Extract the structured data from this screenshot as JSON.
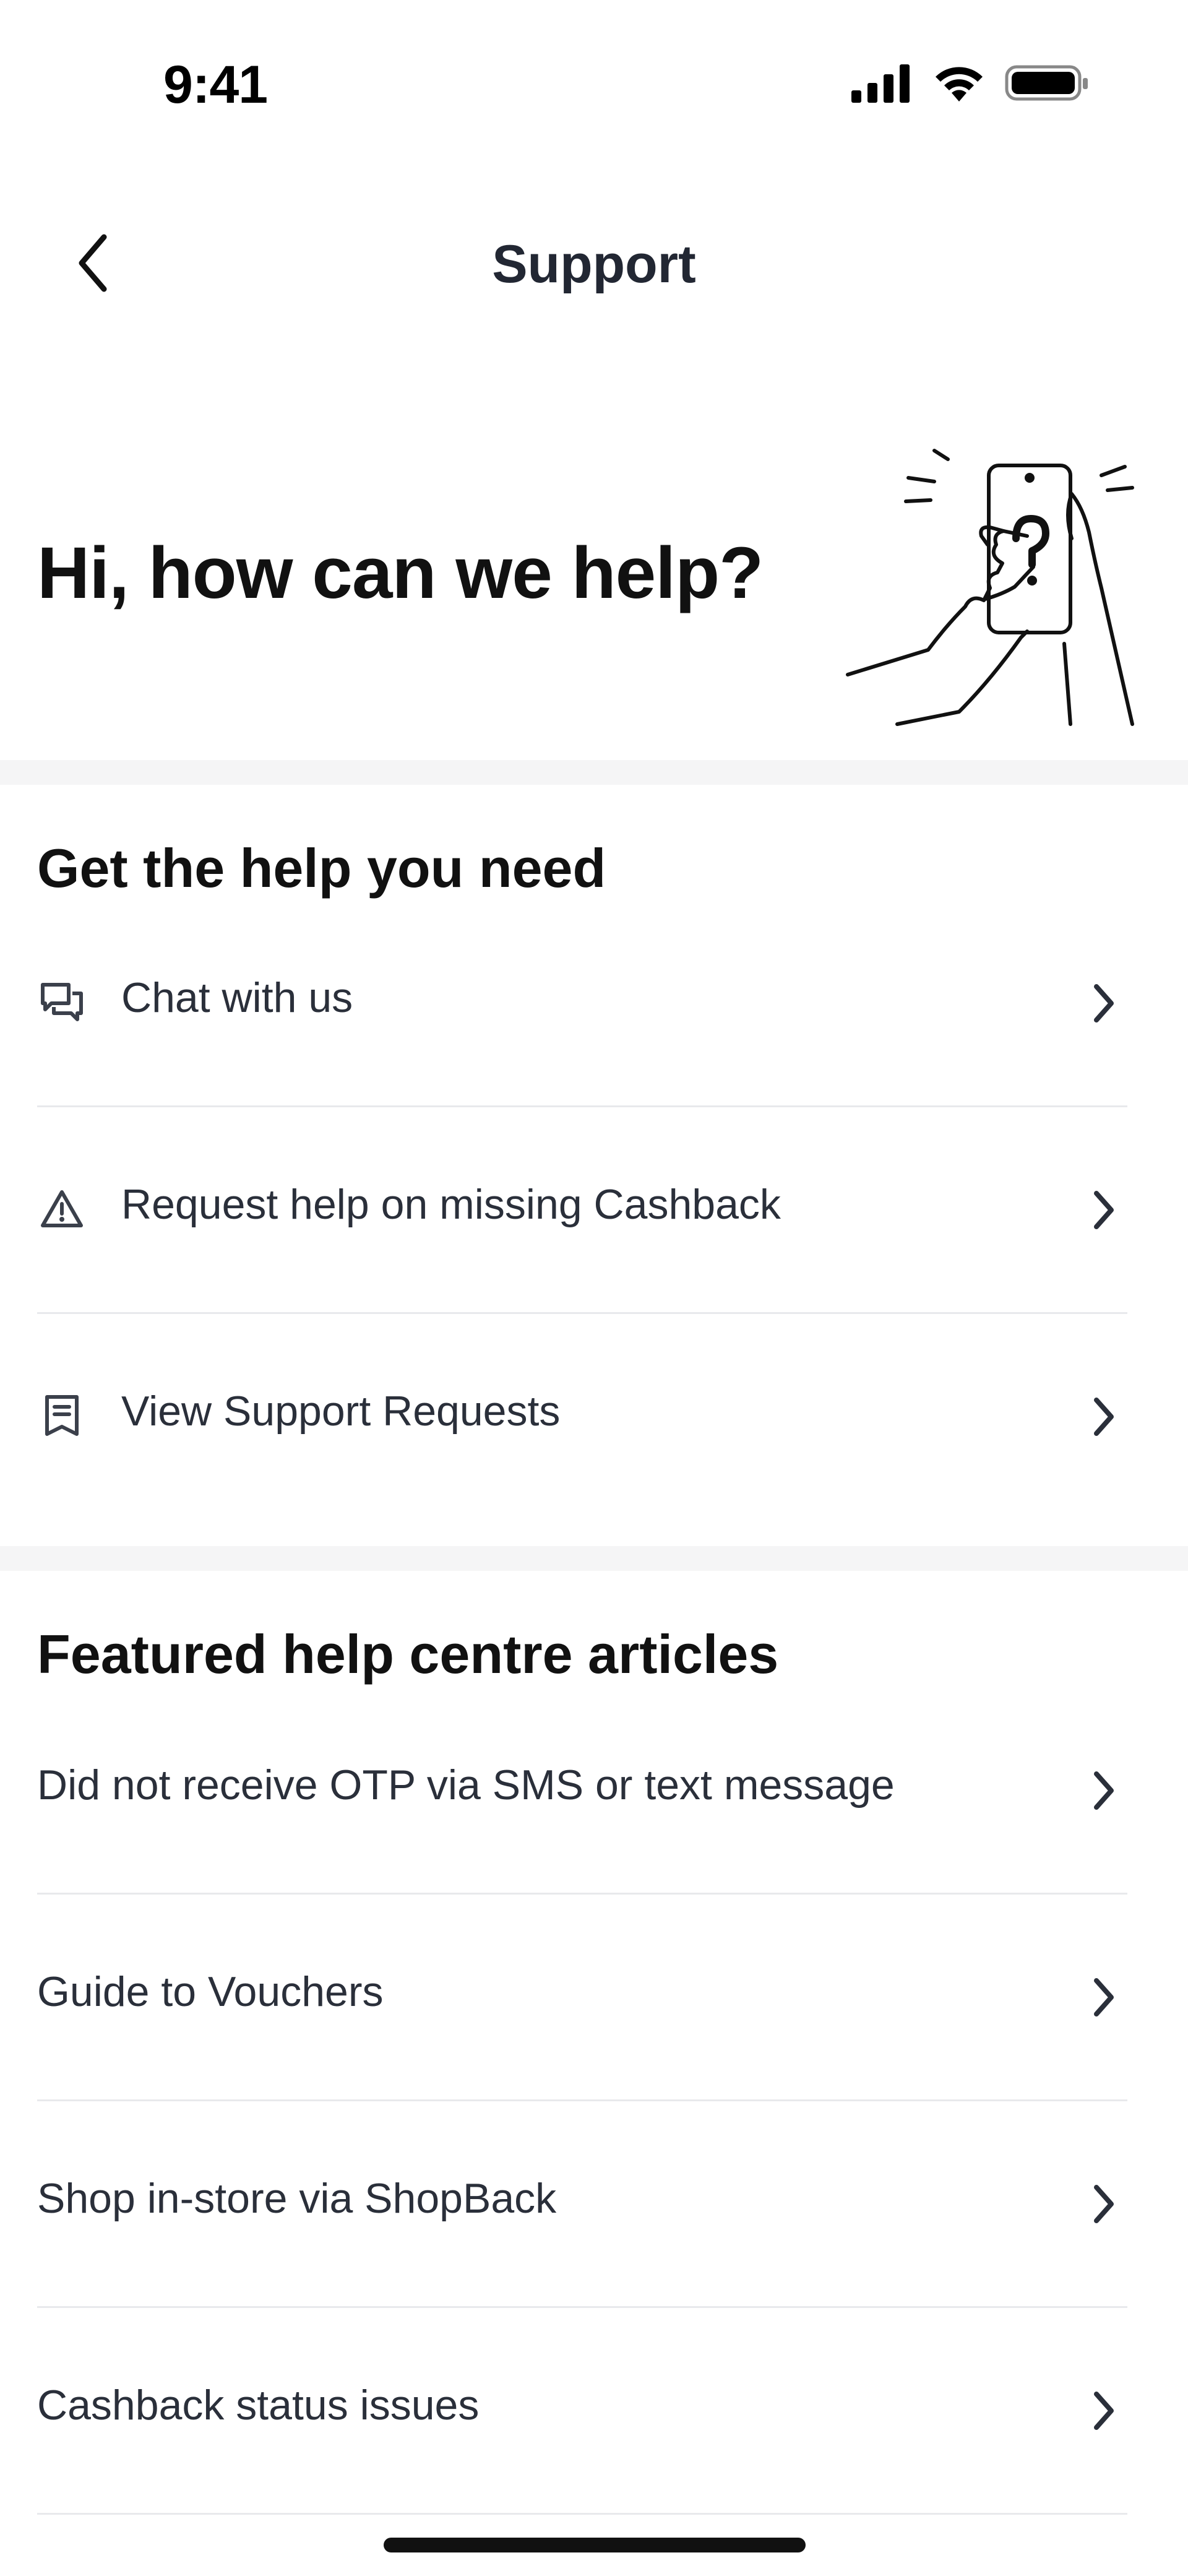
{
  "status_bar": {
    "time": "9:41",
    "icons": [
      "cellular-signal-icon",
      "wifi-icon",
      "battery-icon"
    ]
  },
  "nav": {
    "title": "Support",
    "back_icon": "chevron-left-icon"
  },
  "hero": {
    "heading": "Hi, how can we help?",
    "illustration": "hand-holding-phone-question-mark"
  },
  "help_section": {
    "title": "Get the help you need",
    "items": [
      {
        "icon": "chat-bubbles-icon",
        "label": "Chat with us"
      },
      {
        "icon": "warning-triangle-icon",
        "label": "Request help on missing Cashback"
      },
      {
        "icon": "receipt-icon",
        "label": "View Support Requests"
      }
    ]
  },
  "articles_section": {
    "title": "Featured help centre articles",
    "items": [
      {
        "label": "Did not receive OTP via SMS or text message"
      },
      {
        "label": "Guide to Vouchers"
      },
      {
        "label": "Shop in-store via ShopBack"
      },
      {
        "label": "Cashback status issues"
      }
    ]
  },
  "colors": {
    "text_primary": "#111111",
    "text_row": "#2a2f3a",
    "divider": "#e8e9ec",
    "section_band": "#f5f5f6"
  }
}
